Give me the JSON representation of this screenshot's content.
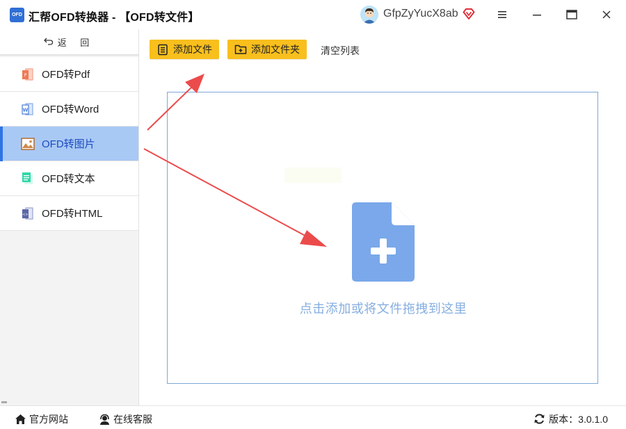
{
  "window": {
    "logo_text": "OFD",
    "title": "汇帮OFD转换器 - 【OFD转文件】",
    "username": "GfpZyYucX8ab",
    "controls": [
      "menu",
      "minimize",
      "maximize",
      "close"
    ]
  },
  "sidebar": {
    "back_label": "返 回",
    "items": [
      {
        "label": "OFD转Pdf",
        "icon": "pdf-icon",
        "active": false
      },
      {
        "label": "OFD转Word",
        "icon": "word-icon",
        "active": false
      },
      {
        "label": "OFD转图片",
        "icon": "image-icon",
        "active": true
      },
      {
        "label": "OFD转文本",
        "icon": "text-icon",
        "active": false
      },
      {
        "label": "OFD转HTML",
        "icon": "html-icon",
        "active": false
      }
    ]
  },
  "toolbar": {
    "add_file_label": "添加文件",
    "add_folder_label": "添加文件夹",
    "clear_label": "清空列表"
  },
  "dropzone": {
    "hint": "点击添加或将文件拖拽到这里"
  },
  "footer": {
    "website_label": "官方网站",
    "support_label": "在线客服",
    "version_label": "版本：3.0.1.0"
  },
  "colors": {
    "accent_yellow": "#f8bf1d",
    "active_item_bg": "#a9c9f5",
    "active_item_text": "#1b4bbf",
    "file_icon": "#7aa8ea",
    "hint_text": "#86aee0",
    "annotation_arrow": "#ec4b4b"
  }
}
